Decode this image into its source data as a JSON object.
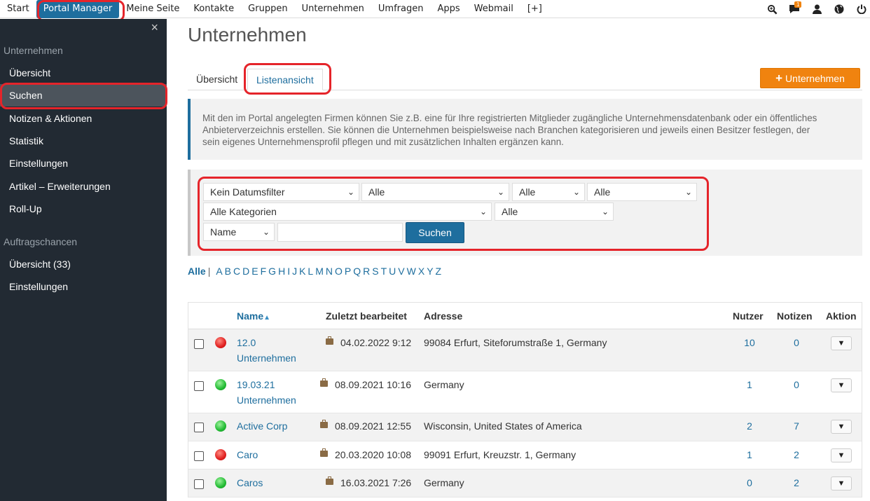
{
  "topnav": {
    "items": [
      "Start",
      "Portal Manager",
      "Meine Seite",
      "Kontakte",
      "Gruppen",
      "Unternehmen",
      "Umfragen",
      "Apps",
      "Webmail",
      "[+]"
    ],
    "active_index": 1,
    "icons": [
      "search-icon",
      "chat-icon",
      "user-icon",
      "globe-icon",
      "power-icon"
    ],
    "chat_badge": "1"
  },
  "sidebar": {
    "close": "×",
    "section1": "Unternehmen",
    "items1": [
      "Übersicht",
      "Suchen",
      "Notizen & Aktionen",
      "Statistik",
      "Einstellungen",
      "Artikel – Erweiterungen",
      "Roll-Up"
    ],
    "active_item": "Suchen",
    "section2": "Auftragschancen",
    "items2": [
      "Übersicht (33)",
      "Einstellungen"
    ]
  },
  "main": {
    "title": "Unternehmen",
    "tabs": [
      "Übersicht",
      "Listenansicht"
    ],
    "active_tab": "Listenansicht",
    "add_button": "Unternehmen",
    "info": "Mit den im Portal angelegten Firmen können Sie z.B. eine für Ihre registrierten Mitglieder zugängliche Unternehmensdatenbank oder ein öffentliches Anbieterverzeichnis erstellen. Sie können die Unternehmen beispielsweise nach Branchen kategorisieren und jeweils einen Besitzer festlegen, der sein eigenes Unternehmensprofil pflegen und mit zusätzlichen Inhalten ergänzen kann."
  },
  "filter": {
    "date_filter": "Kein Datumsfilter",
    "sel2": "Alle",
    "sel3": "Alle",
    "sel4": "Alle",
    "categories": "Alle Kategorien",
    "sel6": "Alle",
    "field": "Name",
    "search_value": "",
    "search_button": "Suchen"
  },
  "alphabet": {
    "all": "Alle",
    "sep": "|",
    "letters": [
      "A",
      "B",
      "C",
      "D",
      "E",
      "F",
      "G",
      "H",
      "I",
      "J",
      "K",
      "L",
      "M",
      "N",
      "O",
      "P",
      "Q",
      "R",
      "S",
      "T",
      "U",
      "V",
      "W",
      "X",
      "Y",
      "Z"
    ]
  },
  "table": {
    "headers": {
      "name": "Name",
      "sort_icon": "sort-up-icon",
      "edited": "Zuletzt bearbeitet",
      "address": "Adresse",
      "users": "Nutzer",
      "notes": "Notizen",
      "action": "Aktion"
    },
    "rows": [
      {
        "status": "red",
        "name_line1": "12.0",
        "name_line2": "Unternehmen",
        "edited": "04.02.2022 9:12",
        "address": "99084 Erfurt, Siteforumstraße 1, Germany",
        "users": "10",
        "notes": "0"
      },
      {
        "status": "green",
        "name_line1": "19.03.21",
        "name_line2": "Unternehmen",
        "edited": "08.09.2021 10:16",
        "address": "Germany",
        "users": "1",
        "notes": "0"
      },
      {
        "status": "green",
        "name_line1": "Active Corp",
        "name_line2": "",
        "edited": "08.09.2021 12:55",
        "address": "Wisconsin, United States of America",
        "users": "2",
        "notes": "7"
      },
      {
        "status": "red",
        "name_line1": "Caro",
        "name_line2": "",
        "edited": "20.03.2020 10:08",
        "address": "99091 Erfurt, Kreuzstr. 1, Germany",
        "users": "1",
        "notes": "2"
      },
      {
        "status": "green",
        "name_line1": "Caros",
        "name_line2": "",
        "edited": "16.03.2021 7:26",
        "address": "Germany",
        "users": "0",
        "notes": "2"
      }
    ]
  },
  "colors": {
    "accent": "#1e6e9e",
    "orange": "#f0830f",
    "sidebar": "#222a33",
    "highlight": "#e5242a"
  }
}
